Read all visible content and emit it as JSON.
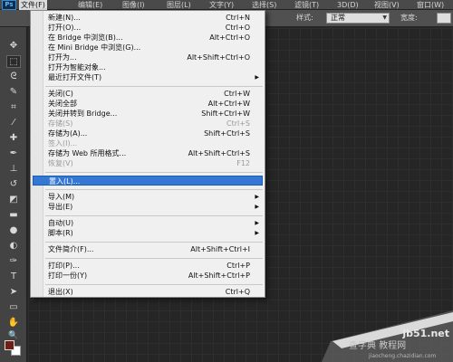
{
  "menubar": {
    "logo": "Ps",
    "items": [
      "文件(F)",
      "编辑(E)",
      "图像(I)",
      "图层(L)",
      "文字(Y)",
      "选择(S)",
      "滤镜(T)",
      "3D(D)",
      "视图(V)",
      "窗口(W)"
    ],
    "active": "文件(F)"
  },
  "options": {
    "style_label": "样式:",
    "style_value": "正常",
    "width_label": "宽度:"
  },
  "tools": [
    "move-tool",
    "marquee-tool",
    "lasso-tool",
    "quick-select-tool",
    "crop-tool",
    "eyedropper-tool",
    "healing-brush-tool",
    "brush-tool",
    "clone-stamp-tool",
    "history-brush-tool",
    "eraser-tool",
    "gradient-tool",
    "blur-tool",
    "dodge-tool",
    "pen-tool",
    "type-tool",
    "path-select-tool",
    "shape-tool",
    "hand-tool",
    "zoom-tool"
  ],
  "colors": {
    "foreground": "#6e2014",
    "background": "#ffffff",
    "highlight": "#3478d4"
  },
  "file_menu": {
    "items": [
      {
        "label": "新建(N)...",
        "shortcut": "Ctrl+N"
      },
      {
        "label": "打开(O)...",
        "shortcut": "Ctrl+O"
      },
      {
        "label": "在 Bridge 中浏览(B)...",
        "shortcut": "Alt+Ctrl+O"
      },
      {
        "label": "在 Mini Bridge 中浏览(G)...",
        "shortcut": ""
      },
      {
        "label": "打开为...",
        "shortcut": "Alt+Shift+Ctrl+O"
      },
      {
        "label": "打开为智能对象...",
        "shortcut": ""
      },
      {
        "label": "最近打开文件(T)",
        "shortcut": "",
        "submenu": true
      },
      {
        "label": "关闭(C)",
        "shortcut": "Ctrl+W"
      },
      {
        "label": "关闭全部",
        "shortcut": "Alt+Ctrl+W"
      },
      {
        "label": "关闭并转到 Bridge...",
        "shortcut": "Shift+Ctrl+W"
      },
      {
        "label": "存储(S)",
        "shortcut": "Ctrl+S",
        "disabled": true
      },
      {
        "label": "存储为(A)...",
        "shortcut": "Shift+Ctrl+S"
      },
      {
        "label": "签入(I)...",
        "shortcut": "",
        "disabled": true
      },
      {
        "label": "存储为 Web 所用格式...",
        "shortcut": "Alt+Shift+Ctrl+S"
      },
      {
        "label": "恢复(V)",
        "shortcut": "F12",
        "disabled": true
      },
      {
        "label": "置入(L)...",
        "shortcut": "",
        "highlighted": true
      },
      {
        "label": "导入(M)",
        "shortcut": "",
        "submenu": true
      },
      {
        "label": "导出(E)",
        "shortcut": "",
        "submenu": true
      },
      {
        "label": "自动(U)",
        "shortcut": "",
        "submenu": true
      },
      {
        "label": "脚本(R)",
        "shortcut": "",
        "submenu": true
      },
      {
        "label": "文件简介(F)...",
        "shortcut": "Alt+Shift+Ctrl+I"
      },
      {
        "label": "打印(P)...",
        "shortcut": "Ctrl+P"
      },
      {
        "label": "打印一份(Y)",
        "shortcut": "Alt+Shift+Ctrl+P"
      },
      {
        "label": "退出(X)",
        "shortcut": "Ctrl+Q"
      }
    ]
  },
  "watermark": {
    "site": "jb51.net",
    "brand": "查字典 教程网",
    "url": "jiaocheng.chazidian.com"
  }
}
